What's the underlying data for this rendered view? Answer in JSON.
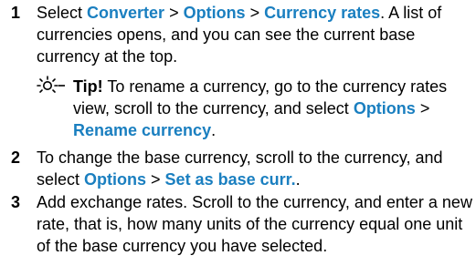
{
  "steps": [
    {
      "num": "1",
      "t1": "Select ",
      "ui1": "Converter",
      "sep1": " > ",
      "ui2": "Options",
      "sep2": " > ",
      "ui3": "Currency rates",
      "t2": ". A list of currencies opens, and you can see the current base currency at the top."
    },
    {
      "num": "2",
      "t1": "To change the base currency, scroll to the currency, and select ",
      "ui1": "Options",
      "sep1": " > ",
      "ui2": "Set as base curr.",
      "t2": "."
    },
    {
      "num": "3",
      "t1": "Add exchange rates. Scroll to the currency, and enter a new rate, that is, how many units of the currency equal one unit of the base currency you have selected."
    }
  ],
  "tip": {
    "label": "Tip!",
    "t1": " To rename a currency, go to the currency rates",
    "t2": "view, scroll to the currency, and select ",
    "ui1": "Options",
    "sep1": " > ",
    "ui2": "Rename currency",
    "t3": "."
  },
  "colors": {
    "ui_link": "#1a7fc0",
    "text": "#000000"
  },
  "icons": {
    "tip": "lightbulb-icon"
  }
}
